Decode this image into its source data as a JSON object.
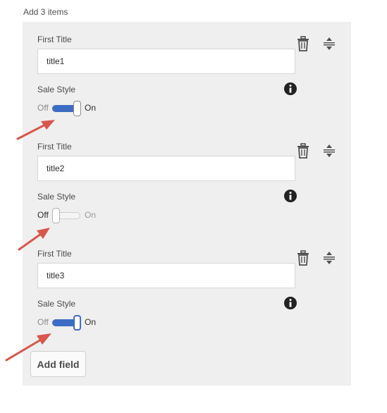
{
  "multifield_label": "Add 3 items",
  "items": [
    {
      "title_label": "First Title",
      "title_value": "title1",
      "sale_label": "Sale Style",
      "toggle_off_label": "Off",
      "toggle_on_label": "On",
      "toggle_checked": true
    },
    {
      "title_label": "First Title",
      "title_value": "title2",
      "sale_label": "Sale Style",
      "toggle_off_label": "Off",
      "toggle_on_label": "On",
      "toggle_checked": false
    },
    {
      "title_label": "First Title",
      "title_value": "title3",
      "sale_label": "Sale Style",
      "toggle_off_label": "Off",
      "toggle_on_label": "On",
      "toggle_checked": true
    }
  ],
  "add_button_label": "Add field",
  "icons": {
    "delete": "trash-icon",
    "reorder": "reorder-icon",
    "info": "info-icon",
    "annotation": "arrow-icon"
  },
  "colors": {
    "panel_background": "#efefef",
    "toggle_on": "#3d6cc4",
    "annotation_arrow": "#d9574a"
  }
}
